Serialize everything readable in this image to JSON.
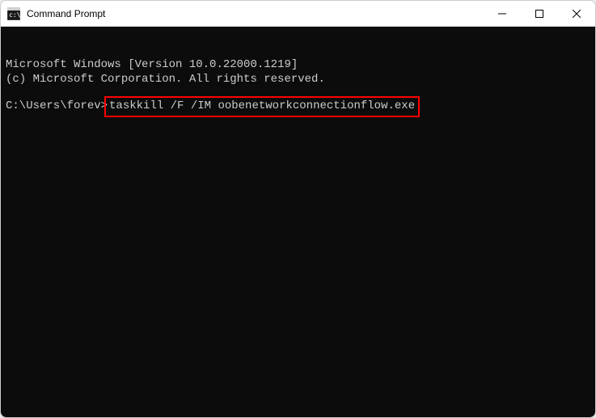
{
  "window": {
    "title": "Command Prompt"
  },
  "terminal": {
    "line1": "Microsoft Windows [Version 10.0.22000.1219]",
    "line2": "(c) Microsoft Corporation. All rights reserved.",
    "prompt": "C:\\Users\\forev>",
    "command": "taskkill /F /IM oobenetworkconnectionflow.exe"
  }
}
